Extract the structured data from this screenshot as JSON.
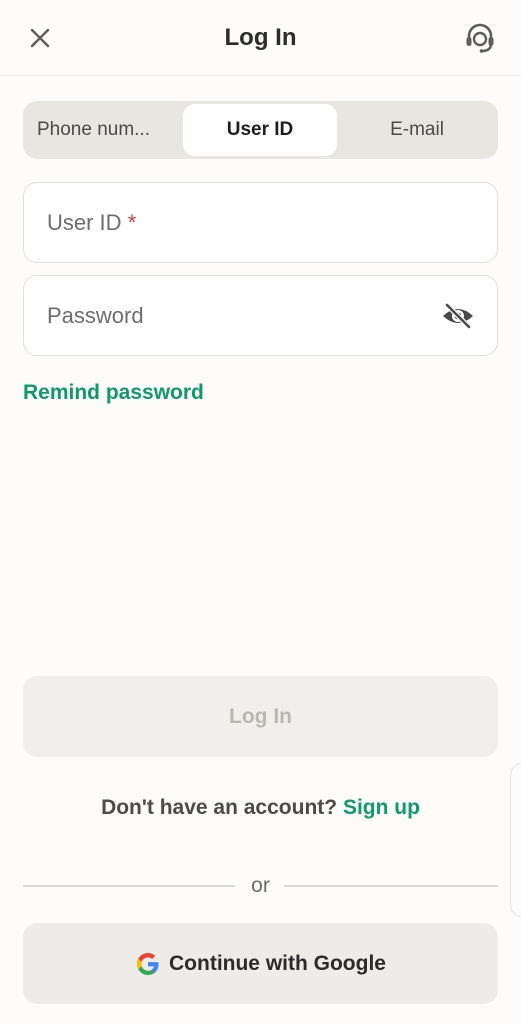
{
  "header": {
    "title": "Log In",
    "close_icon": "close-icon",
    "support_icon": "headset-icon"
  },
  "tabs": [
    {
      "label": "Phone num...",
      "selected": false
    },
    {
      "label": "User ID",
      "selected": true
    },
    {
      "label": "E-mail",
      "selected": false
    }
  ],
  "form": {
    "user_id_label": "User ID",
    "required_mark": "*",
    "password_label": "Password",
    "password_visibility_icon": "eye-off-icon",
    "remind_password": "Remind password"
  },
  "actions": {
    "login_label": "Log In",
    "signup_prompt": "Don't have an account?",
    "signup_link": "Sign up",
    "or_text": "or",
    "google_label": "Continue with Google"
  },
  "colors": {
    "accent": "#0f9a6b",
    "required": "#d13c3c",
    "disabled_text": "#bab7b2"
  }
}
